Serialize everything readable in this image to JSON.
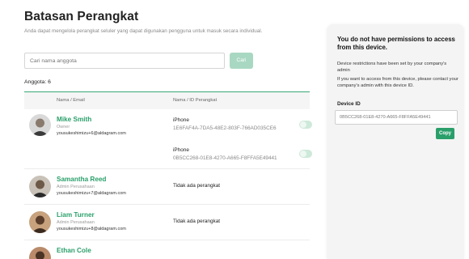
{
  "page": {
    "title": "Batasan Perangkat",
    "description": "Anda dapat mengelola perangkat seluler yang dapat digunakan pengguna untuk masuk secara individual."
  },
  "search": {
    "placeholder": "Cari nama anggota",
    "button_label": "Cari"
  },
  "member_count": "Anggota: 6",
  "table": {
    "headers": {
      "name_email": "Nama / Email",
      "device": "Nama / ID Perangkat"
    },
    "rows": [
      {
        "name": "Mike Smith",
        "role": "Owner",
        "email": "yousukeshimizu+6@aldagram.com",
        "devices": [
          {
            "name": "iPhone",
            "id": "1E6FAF4A-7DA5-48E2-803F-766AD035CE6"
          },
          {
            "name": "iPhone",
            "id": "0B5CC268-01E8-4270-A665-F8FFA5E49441"
          }
        ],
        "no_device": ""
      },
      {
        "name": "Samantha Reed",
        "role": "Admin Perusahaan",
        "email": "yousukeshimizu+7@aldagram.com",
        "devices": [],
        "no_device": "Tidak ada perangkat"
      },
      {
        "name": "Liam Turner",
        "role": "Admin Perusahaan",
        "email": "yousukeshimizu+8@aldagram.com",
        "devices": [],
        "no_device": "Tidak ada perangkat"
      },
      {
        "name": "Ethan Cole",
        "role": "",
        "email": "",
        "devices": [],
        "no_device": ""
      }
    ]
  },
  "panel": {
    "title": "You do not have permissions to access from this device.",
    "message_1": "Device restrictions have been set by your company's admin",
    "message_2": "If you want to access from this device, please contact your company's admin with this device ID.",
    "device_id_label": "Device ID",
    "device_id_value": "0B5CC268-01E8-4270-A665-F8FFA5E49441",
    "copy_label": "Copy"
  },
  "colors": {
    "accent": "#2a9f6a",
    "accent_light": "#a9d8c2",
    "panel_bg": "#f4f4f4"
  }
}
